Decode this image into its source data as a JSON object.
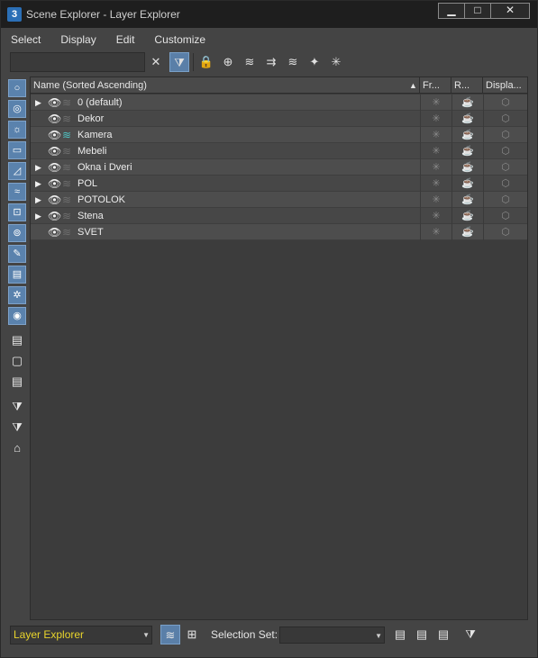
{
  "window": {
    "app_icon": "3",
    "title": "Scene Explorer - Layer Explorer",
    "minimize": "▁",
    "maximize": "□",
    "close": "✕"
  },
  "menu": [
    "Select",
    "Display",
    "Edit",
    "Customize"
  ],
  "toolbar": {
    "search_value": "",
    "clear_icon": "✕",
    "filter_icon": "⧩",
    "lock_icon": "🔒",
    "icons": [
      "⊕",
      "≋",
      "⇉",
      "≋",
      "✦",
      "✳"
    ]
  },
  "leftbar": {
    "filters": [
      "○",
      "◎",
      "☼",
      "▭",
      "◿",
      "≈",
      "⊡",
      "⊚",
      "✎",
      "▤",
      "✲",
      "◉"
    ],
    "tools": [
      "▤",
      "▢",
      "▤",
      "⧩",
      "⧩",
      "⌂"
    ]
  },
  "columns": {
    "name": "Name (Sorted Ascending)",
    "sort_arrow": "▲",
    "frozen": "Fr...",
    "render": "R...",
    "display": "Displa..."
  },
  "rows": [
    {
      "name": "0 (default)",
      "expander": "▶",
      "eye": "👁",
      "layer": "≋",
      "active": false
    },
    {
      "name": "Dekor",
      "expander": "",
      "eye": "👁",
      "layer": "≋",
      "active": false
    },
    {
      "name": "Kamera",
      "expander": "",
      "eye": "👁",
      "layer": "≋",
      "active": true
    },
    {
      "name": "Mebeli",
      "expander": "",
      "eye": "👁",
      "layer": "≋",
      "active": false
    },
    {
      "name": "Okna i Dveri",
      "expander": "▶",
      "eye": "👁",
      "layer": "≋",
      "active": false
    },
    {
      "name": "POL",
      "expander": "▶",
      "eye": "👁",
      "layer": "≋",
      "active": false
    },
    {
      "name": "POTOLOK",
      "expander": "▶",
      "eye": "👁",
      "layer": "≋",
      "active": false
    },
    {
      "name": "Stena",
      "expander": "▶",
      "eye": "👁",
      "layer": "≋",
      "active": false
    },
    {
      "name": "SVET",
      "expander": "",
      "eye": "👁",
      "layer": "≋",
      "active": false
    }
  ],
  "row_icons": {
    "frozen": "✳",
    "render": "☕",
    "display": "⬡"
  },
  "bottom": {
    "explorer_type": "Layer Explorer",
    "dropdown_arrow": "▼",
    "layer_mode_icon": "≋",
    "hierarchy_icon": "⊞",
    "selection_set_label": "Selection Set:",
    "selection_set_value": "",
    "icons": [
      "▤",
      "▤",
      "▤",
      "⧩"
    ]
  },
  "colors": {
    "accent": "#5a7fa8",
    "explorer_label": "#e8d42c",
    "active_layer": "#4fc3c3"
  }
}
